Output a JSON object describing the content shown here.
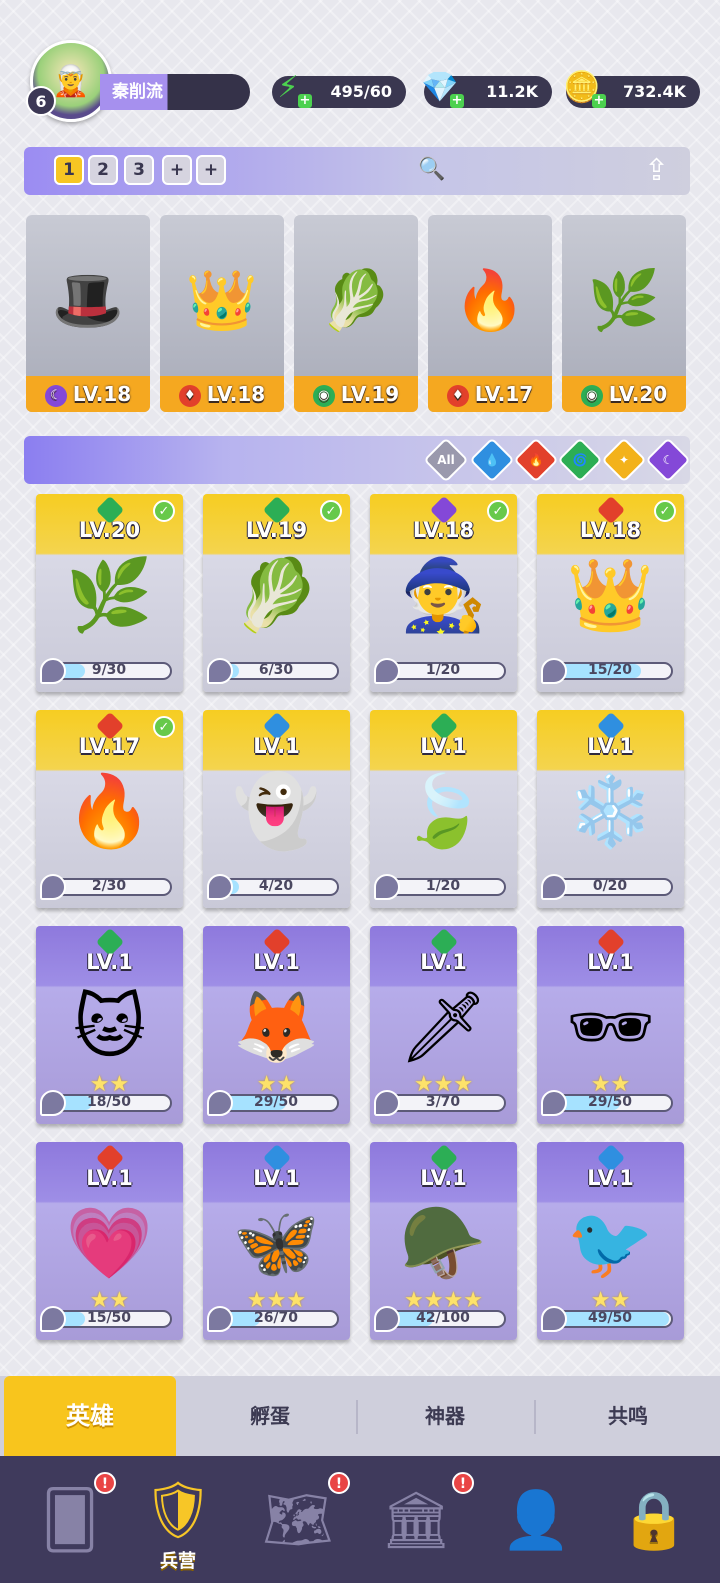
{
  "player": {
    "level": "6",
    "name": "秦削流",
    "avatar_icon": "player-avatar"
  },
  "resources": [
    {
      "name": "energy",
      "value": "495/60",
      "icon": "lightning-icon",
      "color": "#4cd14f"
    },
    {
      "name": "gems",
      "value": "11.2K",
      "icon": "gem-icon",
      "color": "#8a6df2"
    },
    {
      "name": "gold",
      "value": "732.4K",
      "icon": "coin-icon",
      "color": "#f5b40c"
    }
  ],
  "team_tabs": [
    "1",
    "2",
    "3",
    "+",
    "+"
  ],
  "team": [
    {
      "element": "dark",
      "level": "LV.18"
    },
    {
      "element": "fire",
      "level": "LV.18"
    },
    {
      "element": "wind",
      "level": "LV.19"
    },
    {
      "element": "fire",
      "level": "LV.17"
    },
    {
      "element": "wind",
      "level": "LV.20"
    }
  ],
  "filters": [
    "All",
    "water",
    "fire",
    "wind",
    "light",
    "dark"
  ],
  "element_colors": {
    "water": "#2f8fe0",
    "fire": "#e2402b",
    "wind": "#2cae55",
    "light": "#f3b21a",
    "dark": "#8448d8",
    "all": "#9a99ad"
  },
  "heroes": [
    {
      "rarity": "gold",
      "element": "wind",
      "level": "LV.20",
      "checked": true,
      "stars": "",
      "progress": "9/30",
      "ratio": 0.3
    },
    {
      "rarity": "gold",
      "element": "wind",
      "level": "LV.19",
      "checked": true,
      "stars": "",
      "progress": "6/30",
      "ratio": 0.2
    },
    {
      "rarity": "gold",
      "element": "dark",
      "level": "LV.18",
      "checked": true,
      "stars": "",
      "progress": "1/20",
      "ratio": 0.05
    },
    {
      "rarity": "gold",
      "element": "fire",
      "level": "LV.18",
      "checked": true,
      "stars": "",
      "progress": "15/20",
      "ratio": 0.75
    },
    {
      "rarity": "gold",
      "element": "fire",
      "level": "LV.17",
      "checked": true,
      "stars": "",
      "progress": "2/30",
      "ratio": 0.07
    },
    {
      "rarity": "gold",
      "element": "water",
      "level": "LV.1",
      "checked": false,
      "stars": "",
      "progress": "4/20",
      "ratio": 0.2
    },
    {
      "rarity": "gold",
      "element": "wind",
      "level": "LV.1",
      "checked": false,
      "stars": "",
      "progress": "1/20",
      "ratio": 0.05
    },
    {
      "rarity": "gold",
      "element": "water",
      "level": "LV.1",
      "checked": false,
      "stars": "",
      "progress": "0/20",
      "ratio": 0
    },
    {
      "rarity": "purple",
      "element": "wind",
      "level": "LV.1",
      "checked": false,
      "stars": "★★",
      "progress": "18/50",
      "ratio": 0.36
    },
    {
      "rarity": "purple",
      "element": "fire",
      "level": "LV.1",
      "checked": false,
      "stars": "★★",
      "progress": "29/50",
      "ratio": 0.58
    },
    {
      "rarity": "purple",
      "element": "wind",
      "level": "LV.1",
      "checked": false,
      "stars": "★★★",
      "progress": "3/70",
      "ratio": 0.04
    },
    {
      "rarity": "purple",
      "element": "fire",
      "level": "LV.1",
      "checked": false,
      "stars": "★★",
      "progress": "29/50",
      "ratio": 0.58
    },
    {
      "rarity": "purple",
      "element": "fire",
      "level": "LV.1",
      "checked": false,
      "stars": "★★",
      "progress": "15/50",
      "ratio": 0.3
    },
    {
      "rarity": "purple",
      "element": "water",
      "level": "LV.1",
      "checked": false,
      "stars": "★★★",
      "progress": "26/70",
      "ratio": 0.37
    },
    {
      "rarity": "purple",
      "element": "wind",
      "level": "LV.1",
      "checked": false,
      "stars": "★★★★",
      "progress": "42/100",
      "ratio": 0.42
    },
    {
      "rarity": "purple",
      "element": "water",
      "level": "LV.1",
      "checked": false,
      "stars": "★★",
      "progress": "49/50",
      "ratio": 0.98
    }
  ],
  "sub_tabs": [
    "英雄",
    "孵蛋",
    "神器",
    "共鸣"
  ],
  "nav": [
    {
      "icon": "cards-icon",
      "label": "",
      "badge": "!"
    },
    {
      "icon": "barracks-icon",
      "label": "兵营",
      "badge": ""
    },
    {
      "icon": "map-icon",
      "label": "",
      "badge": "!"
    },
    {
      "icon": "temple-icon",
      "label": "",
      "badge": "!"
    },
    {
      "icon": "hood-icon",
      "label": "",
      "badge": ""
    },
    {
      "icon": "lock-icon",
      "label": "",
      "badge": ""
    }
  ]
}
